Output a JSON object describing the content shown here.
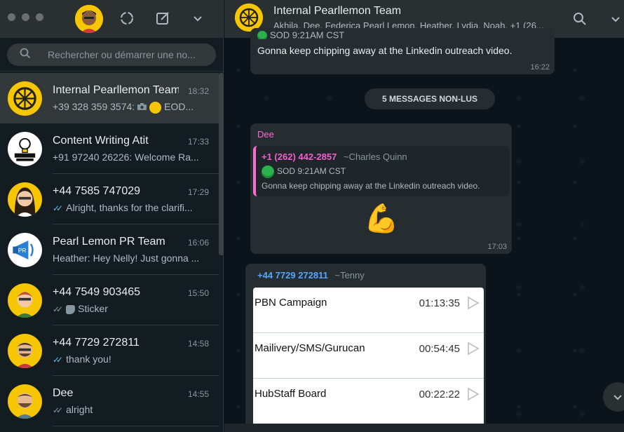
{
  "left_header": {
    "icons": [
      "status-icon",
      "new-chat-icon",
      "menu-chevron-icon"
    ]
  },
  "search": {
    "placeholder": "Rechercher ou démarrer une no..."
  },
  "chats": [
    {
      "name": "Internal Pearllemon Team",
      "time": "18:32",
      "preview_prefix": "+39 328 359 3574:",
      "preview": "EOD...",
      "tick": "none",
      "avatar": "lemon"
    },
    {
      "name": "Content Writing Atit",
      "time": "17:33",
      "preview_prefix": "",
      "preview": "+91 97240 26226: Welcome Ra...",
      "tick": "none",
      "avatar": "smart"
    },
    {
      "name": "+44 7585 747029",
      "time": "17:29",
      "preview_prefix": "",
      "preview": "Alright, thanks for the clarifi...",
      "tick": "blue",
      "avatar": "woman"
    },
    {
      "name": "Pearl Lemon PR Team",
      "time": "16:06",
      "preview_prefix": "",
      "preview": "Heather: Hey Nelly! Just gonna ...",
      "tick": "none",
      "avatar": "pr"
    },
    {
      "name": "+44 7549 903465",
      "time": "15:50",
      "preview_prefix": "",
      "preview": "Sticker",
      "tick": "grey",
      "avatar": "man1"
    },
    {
      "name": "+44 7729 272811",
      "time": "14:58",
      "preview_prefix": "",
      "preview": "thank you!",
      "tick": "blue",
      "avatar": "man2"
    },
    {
      "name": "Dee",
      "time": "14:55",
      "preview_prefix": "",
      "preview": "alright",
      "tick": "grey",
      "avatar": "man3"
    }
  ],
  "conversation": {
    "title": "Internal Pearllemon Team",
    "members": "Akhila, Dee, Federica Pearl Lemon, Heather, Lydia, Noah, +1 (26..."
  },
  "messages": {
    "top_partial": {
      "text": "Gonna keep chipping away at the Linkedin outreach video.",
      "time": "16:22",
      "partial_label": "SOD 9:21AM CST"
    },
    "unread_banner": "5 MESSAGES NON-LUS",
    "dee_msg": {
      "sender": "Dee",
      "quote_sender": "+1 (262) 442-2857",
      "quote_alias": "~Charles Quinn",
      "quote_line1": "SOD 9:21AM CST",
      "quote_line2": "Gonna keep chipping away at the Linkedin outreach video.",
      "emoji": "💪",
      "time": "17:03"
    },
    "tenny_msg": {
      "sender": "+44 7729 272811",
      "alias": "~Tenny",
      "rows": [
        {
          "name": "PBN Campaign",
          "duration": "01:13:35"
        },
        {
          "name": "Mailivery/SMS/Gurucan",
          "duration": "00:54:45"
        },
        {
          "name": "HubStaff Board",
          "duration": "00:22:22"
        }
      ]
    }
  },
  "colors": {
    "accent_blue": "#53bdeb",
    "dee_pink": "#fc6bd0",
    "quote_pink": "#f15ed0",
    "tenny_blue": "#53a6fd",
    "lemon_yellow": "#f6c700"
  }
}
